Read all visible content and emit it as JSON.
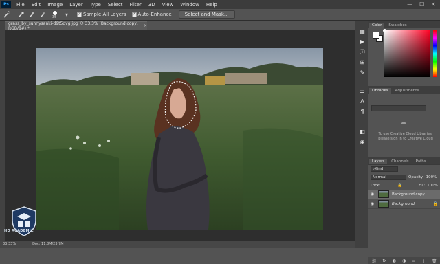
{
  "app": {
    "logo": "Ps"
  },
  "menu": [
    "File",
    "Edit",
    "Image",
    "Layer",
    "Type",
    "Select",
    "Filter",
    "3D",
    "View",
    "Window",
    "Help"
  ],
  "window_controls": [
    "—",
    "☐",
    "✕"
  ],
  "options_bar": {
    "brush_size": "35",
    "sample_all_layers_label": "Sample All Layers",
    "sample_all_layers_checked": true,
    "auto_enhance_label": "Auto-Enhance",
    "auto_enhance_checked": true,
    "select_and_mask_label": "Select and Mask..."
  },
  "document": {
    "tab_title": "grass_by_sunnysanki-d9t5dvg.jpg @ 33.3% (Background copy, RGB/8#) *",
    "close_glyph": "×"
  },
  "status_bar": {
    "zoom": "33.33%",
    "doc_info": "Doc: 11.8M/23.7M"
  },
  "watermark": {
    "text": "HD ACADEMIC"
  },
  "panels": {
    "color_tabs": [
      "Color",
      "Swatches"
    ],
    "libraries_tabs": [
      "Libraries",
      "Adjustments"
    ],
    "libraries_message": "To use Creative Cloud Libraries, please sign in to Creative Cloud",
    "layers_tabs": [
      "Layers",
      "Channels",
      "Paths"
    ],
    "kind_filter": "Kind",
    "blend_mode": "Normal",
    "opacity_label": "Opacity:",
    "opacity_value": "100%",
    "lock_label": "Lock:",
    "fill_label": "Fill:",
    "fill_value": "100%",
    "layers": [
      {
        "name": "Background copy",
        "selected": true,
        "italic": false
      },
      {
        "name": "Background",
        "selected": false,
        "italic": true
      }
    ]
  }
}
